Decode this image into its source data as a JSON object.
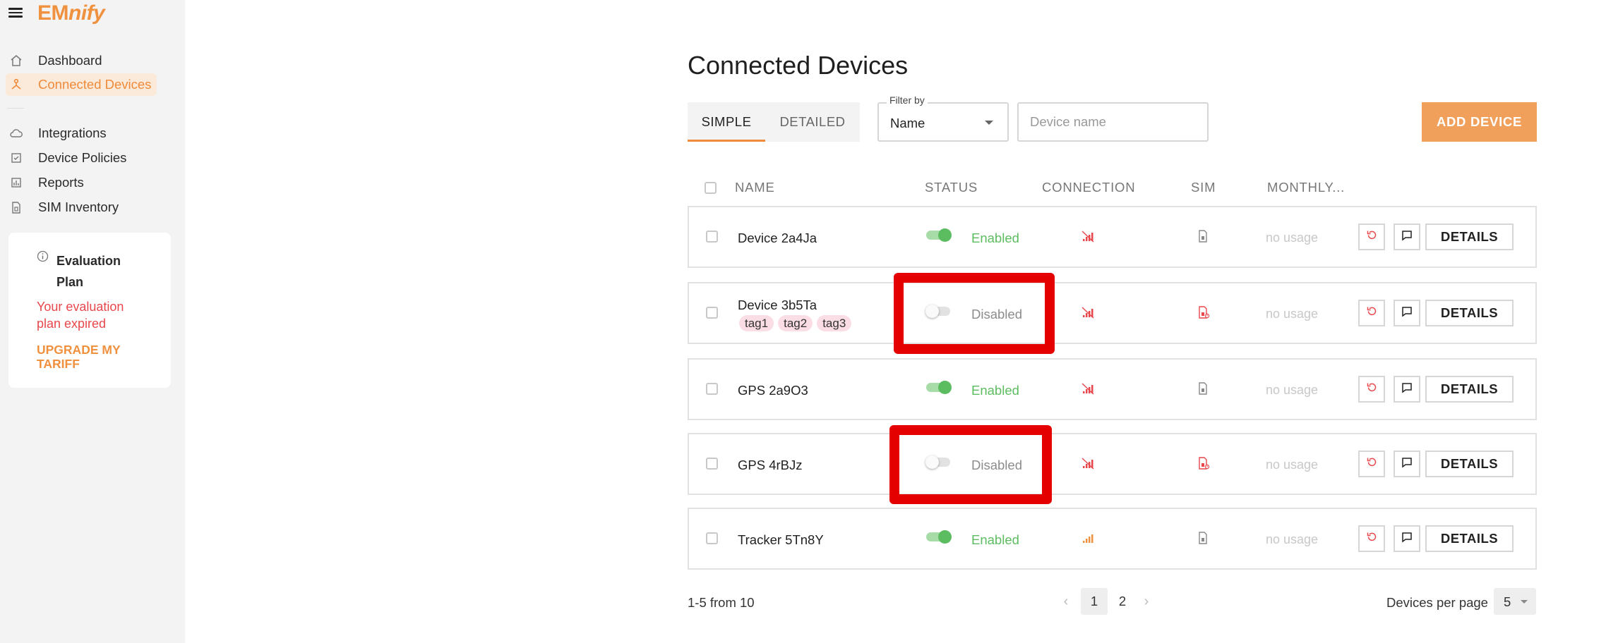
{
  "app": {
    "logo_prefix": "EM",
    "logo_suffix": "nify"
  },
  "sidebar": {
    "items": [
      {
        "label": "Dashboard",
        "icon": "home-icon"
      },
      {
        "label": "Connected Devices",
        "icon": "devices-icon",
        "active": true
      },
      {
        "label": "Integrations",
        "icon": "cloud-icon"
      },
      {
        "label": "Device Policies",
        "icon": "policy-icon"
      },
      {
        "label": "Reports",
        "icon": "chart-icon"
      },
      {
        "label": "SIM Inventory",
        "icon": "sim-icon"
      }
    ],
    "evaluation": {
      "title": "Evaluation Plan",
      "message": "Your evaluation plan expired",
      "upgrade_link": "UPGRADE MY TARIFF"
    }
  },
  "main": {
    "title": "Connected Devices",
    "tabs": [
      {
        "label": "SIMPLE",
        "active": true
      },
      {
        "label": "DETAILED"
      }
    ],
    "filter": {
      "label": "Filter by",
      "value": "Name"
    },
    "search": {
      "placeholder": "Device name"
    },
    "add_button": "ADD DEVICE",
    "columns": [
      "NAME",
      "STATUS",
      "CONNECTION",
      "SIM",
      "MONTHLY..."
    ],
    "rows": [
      {
        "name": "Device 2a4Ja",
        "tags": [],
        "status": "Enabled",
        "enabled": true,
        "connection": "no-signal",
        "sim": "sim-ok",
        "usage": "no usage",
        "details": "DETAILS"
      },
      {
        "name": "Device 3b5Ta",
        "tags": [
          "tag1",
          "tag2",
          "tag3"
        ],
        "status": "Disabled",
        "enabled": false,
        "connection": "no-signal",
        "sim": "sim-error",
        "usage": "no usage",
        "details": "DETAILS"
      },
      {
        "name": "GPS 2a9O3",
        "tags": [],
        "status": "Enabled",
        "enabled": true,
        "connection": "no-signal",
        "sim": "sim-ok",
        "usage": "no usage",
        "details": "DETAILS"
      },
      {
        "name": "GPS 4rBJz",
        "tags": [],
        "status": "Disabled",
        "enabled": false,
        "connection": "no-signal",
        "sim": "sim-error",
        "usage": "no usage",
        "details": "DETAILS"
      },
      {
        "name": "Tracker 5Tn8Y",
        "tags": [],
        "status": "Enabled",
        "enabled": true,
        "connection": "signal-full",
        "sim": "sim-ok",
        "usage": "no usage",
        "details": "DETAILS"
      }
    ],
    "pagination": {
      "range_text": "1-5 from 10",
      "pages": [
        "1",
        "2"
      ],
      "current_page": "1",
      "per_page_label": "Devices per page",
      "per_page_value": "5"
    }
  },
  "colors": {
    "accent": "#f0913f",
    "enabled": "#5cbc60",
    "error": "#e8474c",
    "highlight": "#e50000"
  }
}
